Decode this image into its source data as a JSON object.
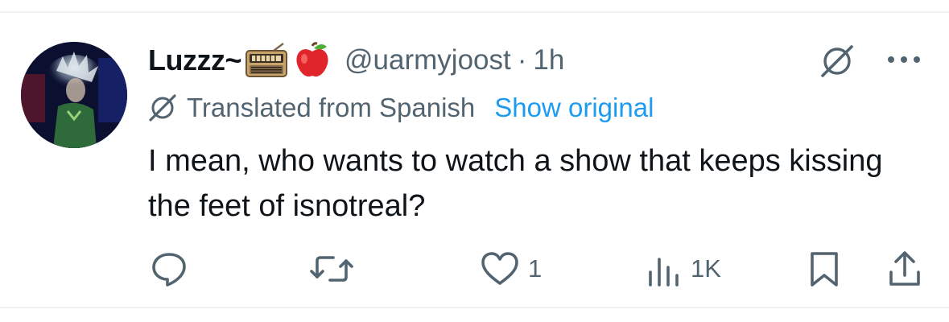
{
  "tweet": {
    "display_name": "Luzzz~",
    "name_emojis": [
      "radio-emoji",
      "red-apple-emoji"
    ],
    "handle": "@uarmyjoost",
    "separator": "·",
    "time": "1h",
    "translation": {
      "label": "Translated from Spanish",
      "link": "Show original"
    },
    "text": "I mean, who wants to watch a show that keeps kissing the feet of isnotreal?",
    "actions": {
      "reply_count": "",
      "retweet_count": "",
      "like_count": "1",
      "views_count": "1K"
    }
  },
  "icons": {
    "grok": "grok-icon",
    "more": "more-icon",
    "reply": "reply-icon",
    "retweet": "retweet-icon",
    "like": "heart-icon",
    "views": "views-icon",
    "bookmark": "bookmark-icon",
    "share": "share-icon"
  },
  "colors": {
    "text": "#0f1419",
    "secondary": "#536471",
    "link": "#1d9bf0",
    "divider": "#eff3f4"
  }
}
